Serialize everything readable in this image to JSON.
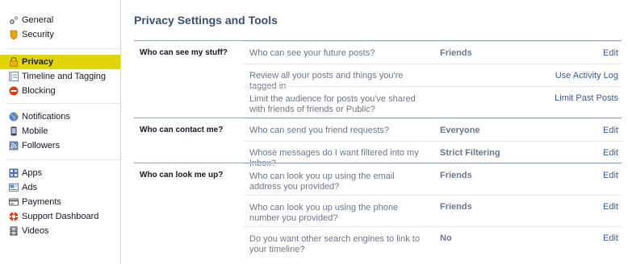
{
  "sidebar": {
    "groups": [
      [
        {
          "label": "General",
          "icon": "gears-icon"
        },
        {
          "label": "Security",
          "icon": "security-badge-icon"
        }
      ],
      [
        {
          "label": "Privacy",
          "icon": "privacy-lock-icon",
          "active": true
        },
        {
          "label": "Timeline and Tagging",
          "icon": "timeline-icon"
        },
        {
          "label": "Blocking",
          "icon": "blocking-icon"
        }
      ],
      [
        {
          "label": "Notifications",
          "icon": "globe-icon"
        },
        {
          "label": "Mobile",
          "icon": "mobile-phone-icon"
        },
        {
          "label": "Followers",
          "icon": "rss-icon"
        }
      ],
      [
        {
          "label": "Apps",
          "icon": "apps-icon"
        },
        {
          "label": "Ads",
          "icon": "ads-icon"
        },
        {
          "label": "Payments",
          "icon": "credit-card-icon"
        },
        {
          "label": "Support Dashboard",
          "icon": "lifebuoy-icon"
        },
        {
          "label": "Videos",
          "icon": "film-icon"
        }
      ]
    ]
  },
  "main": {
    "title": "Privacy Settings and Tools",
    "sections": [
      {
        "label": "Who can see my stuff?",
        "rows": [
          {
            "question": "Who can see your future posts?",
            "value": "Friends",
            "action": "Edit"
          },
          {
            "question": "Review all your posts and things you're tagged in",
            "value": "",
            "action": "Use Activity Log"
          },
          {
            "question": "Limit the audience for posts you've shared with friends of friends or Public?",
            "value": "",
            "action": "Limit Past Posts"
          }
        ]
      },
      {
        "label": "Who can contact me?",
        "rows": [
          {
            "question": "Who can send you friend requests?",
            "value": "Everyone",
            "action": "Edit"
          },
          {
            "question": "Whose messages do I want filtered into my Inbox?",
            "value": "Strict Filtering",
            "action": "Edit"
          }
        ]
      },
      {
        "label": "Who can look me up?",
        "rows": [
          {
            "question": "Who can look you up using the email address you provided?",
            "value": "Friends",
            "action": "Edit"
          },
          {
            "question": "Who can look you up using the phone number you provided?",
            "value": "Friends",
            "action": "Edit"
          },
          {
            "question": "Do you want other search engines to link to your timeline?",
            "value": "No",
            "action": "Edit"
          }
        ]
      }
    ]
  },
  "colors": {
    "accent_highlight": "#e2d40b",
    "link": "#3b5998",
    "title": "#3b4f75",
    "muted_text": "#6d7689"
  }
}
